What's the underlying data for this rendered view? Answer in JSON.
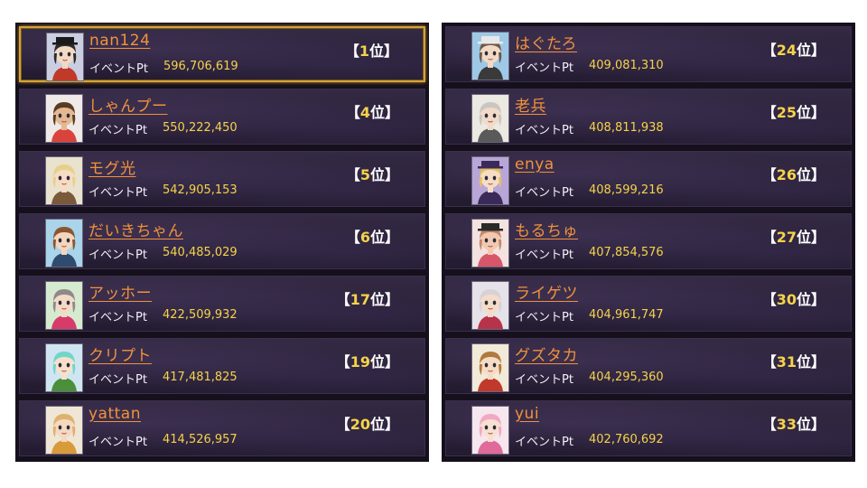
{
  "points_label": "イベントPt",
  "rank_open": "【",
  "rank_suffix": "位】",
  "left_column": [
    {
      "name": "nan124",
      "points": "596,706,619",
      "rank": "1",
      "highlighted": true,
      "avatar": {
        "hair": "#2a2a2a",
        "skin": "#f3d9c4",
        "hat": "#1a1a1a",
        "bg": "#c9cfe0",
        "accent": "#c0392b"
      }
    },
    {
      "name": "しゃんプー",
      "points": "550,222,450",
      "rank": "4",
      "highlighted": false,
      "avatar": {
        "hair": "#5a3b22",
        "skin": "#e3b892",
        "hat": "",
        "bg": "#efeae8",
        "accent": "#d9433b"
      }
    },
    {
      "name": "モグ光",
      "points": "542,905,153",
      "rank": "5",
      "highlighted": false,
      "avatar": {
        "hair": "#e6d08a",
        "skin": "#f6dcc4",
        "hat": "",
        "bg": "#e9e2cf",
        "accent": "#7a5a3a"
      }
    },
    {
      "name": "だいきちゃん",
      "points": "540,485,029",
      "rank": "6",
      "highlighted": false,
      "avatar": {
        "hair": "#8a5632",
        "skin": "#f5d6bd",
        "hat": "",
        "bg": "#a9d4ea",
        "accent": "#2f4b6e"
      }
    },
    {
      "name": "アッホー",
      "points": "422,509,932",
      "rank": "17",
      "highlighted": false,
      "avatar": {
        "hair": "#8f8a8a",
        "skin": "#f4dac6",
        "hat": "",
        "bg": "#d6ead0",
        "accent": "#d83a6a"
      }
    },
    {
      "name": "クリプト",
      "points": "417,481,825",
      "rank": "19",
      "highlighted": false,
      "avatar": {
        "hair": "#6fd6c8",
        "skin": "#f6e0cc",
        "hat": "",
        "bg": "#cfe6f2",
        "accent": "#4a8f3a"
      }
    },
    {
      "name": "yattan",
      "points": "414,526,957",
      "rank": "20",
      "highlighted": false,
      "avatar": {
        "hair": "#e0b070",
        "skin": "#f4d8c0",
        "hat": "",
        "bg": "#efe6d6",
        "accent": "#d99a3a"
      }
    }
  ],
  "right_column": [
    {
      "name": "はぐたろ",
      "points": "409,081,310",
      "rank": "24",
      "highlighted": false,
      "avatar": {
        "hair": "#6b5a4a",
        "skin": "#f3d9c4",
        "hat": "#e8e8e8",
        "bg": "#9ec9e6",
        "accent": "#3a3a3a"
      }
    },
    {
      "name": "老兵",
      "points": "408,811,938",
      "rank": "25",
      "highlighted": false,
      "avatar": {
        "hair": "#c9c6c2",
        "skin": "#f1dac8",
        "hat": "",
        "bg": "#ece8e2",
        "accent": "#5a5a5a"
      }
    },
    {
      "name": "enya",
      "points": "408,599,216",
      "rank": "26",
      "highlighted": false,
      "avatar": {
        "hair": "#e3c15e",
        "skin": "#f6ddc6",
        "hat": "#3a2a5a",
        "bg": "#b8a6d8",
        "accent": "#3a2a5a"
      }
    },
    {
      "name": "もるちゅ",
      "points": "407,854,576",
      "rank": "27",
      "highlighted": false,
      "avatar": {
        "hair": "#c48a6a",
        "skin": "#f2c9b0",
        "hat": "#2a2a2a",
        "bg": "#f3e2e0",
        "accent": "#d8566a"
      }
    },
    {
      "name": "ライゲツ",
      "points": "404,961,747",
      "rank": "30",
      "highlighted": false,
      "avatar": {
        "hair": "#d8d2d6",
        "skin": "#f5dcc8",
        "hat": "",
        "bg": "#e6e2ea",
        "accent": "#b8324a"
      }
    },
    {
      "name": "グズタカ",
      "points": "404,295,360",
      "rank": "31",
      "highlighted": false,
      "avatar": {
        "hair": "#b07a3e",
        "skin": "#f6dcc4",
        "hat": "",
        "bg": "#f2ead8",
        "accent": "#c0392b"
      }
    },
    {
      "name": "yui",
      "points": "402,760,692",
      "rank": "33",
      "highlighted": false,
      "avatar": {
        "hair": "#f2a8c4",
        "skin": "#f8e0d0",
        "hat": "",
        "bg": "#f6e6ee",
        "accent": "#e06a9a"
      }
    }
  ]
}
